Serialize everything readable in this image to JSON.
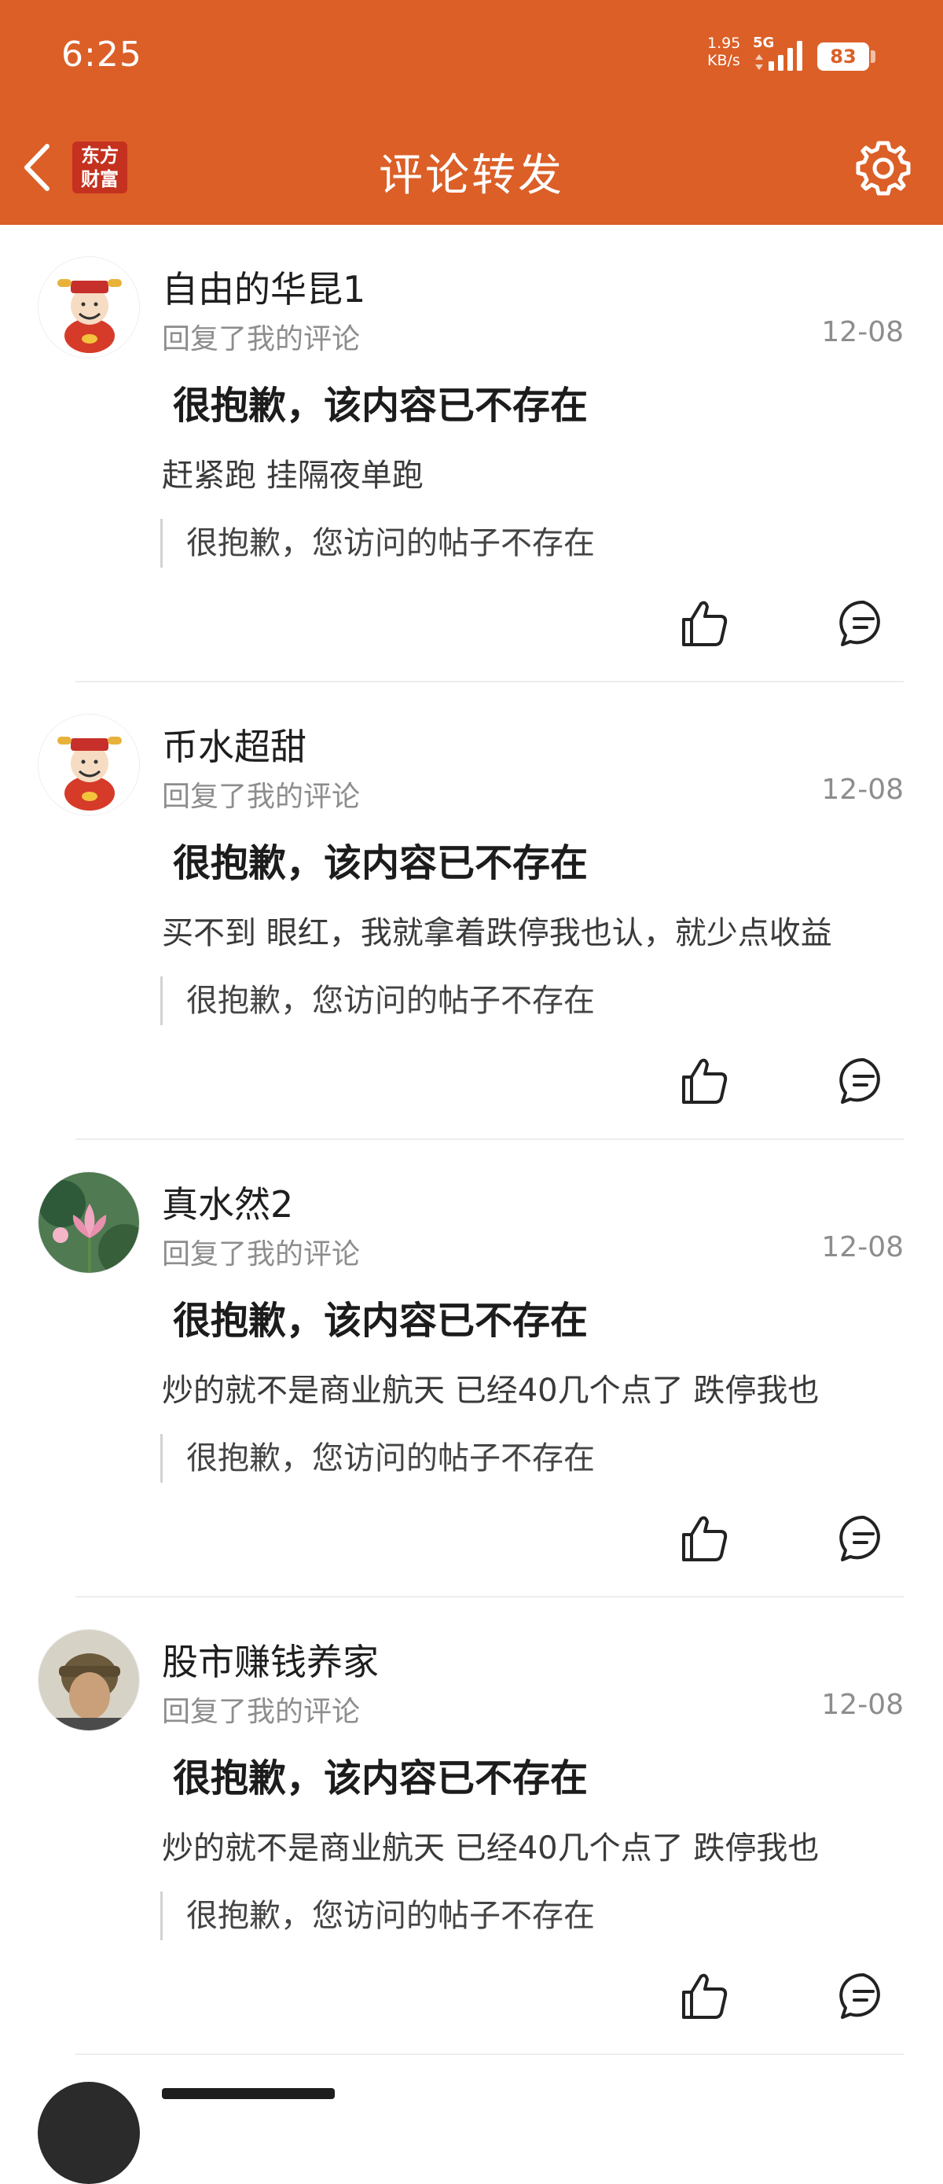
{
  "status_bar": {
    "time": "6:25",
    "net_speed_value": "1.95",
    "net_speed_unit": "KB/s",
    "network": "5G",
    "battery": "83"
  },
  "nav": {
    "logo_line1": "东方",
    "logo_line2": "财富",
    "title": "评论转发",
    "accent_color": "#db5f27"
  },
  "comments": [
    {
      "username": "自由的华昆1",
      "reply_label": "回复了我的评论",
      "date": "12-08",
      "deleted_title": "很抱歉，该内容已不存在",
      "text": "赶紧跑 挂隔夜单跑",
      "quote": "很抱歉，您访问的帖子不存在",
      "avatar": "cartoon-mascot-avatar"
    },
    {
      "username": "币水超甜",
      "reply_label": "回复了我的评论",
      "date": "12-08",
      "deleted_title": "很抱歉，该内容已不存在",
      "text": "买不到 眼红，我就拿着跌停我也认，就少点收益",
      "quote": "很抱歉，您访问的帖子不存在",
      "avatar": "cartoon-mascot-avatar"
    },
    {
      "username": "真水然2",
      "reply_label": "回复了我的评论",
      "date": "12-08",
      "deleted_title": "很抱歉，该内容已不存在",
      "text": "炒的就不是商业航天 已经40几个点了 跌停我也",
      "quote": "很抱歉，您访问的帖子不存在",
      "avatar": "lotus-photo-avatar"
    },
    {
      "username": "股市赚钱养家",
      "reply_label": "回复了我的评论",
      "date": "12-08",
      "deleted_title": "很抱歉，该内容已不存在",
      "text": "炒的就不是商业航天 已经40几个点了 跌停我也",
      "quote": "很抱歉，您访问的帖子不存在",
      "avatar": "person-photo-avatar"
    }
  ]
}
